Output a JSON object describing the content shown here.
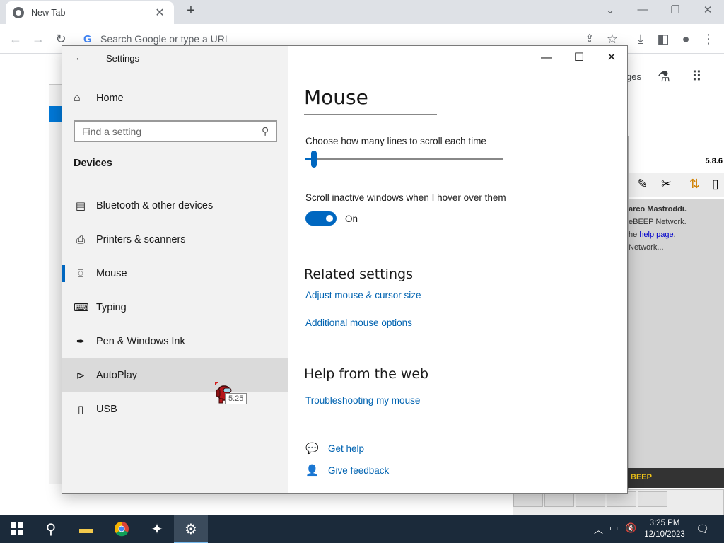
{
  "browser": {
    "tab_title": "New Tab",
    "tab_close": "✕",
    "new_tab": "+",
    "omnibox_placeholder": "Search Google or type a URL",
    "right_partial_text": "ges"
  },
  "beep": {
    "version": "5.8.6",
    "lines": [
      "arco Mastroddi.",
      "eBEEP Network.",
      "he",
      "help page",
      ".",
      "Network..."
    ],
    "footer": "BEEP"
  },
  "settings": {
    "window_title": "Settings",
    "home_label": "Home",
    "search_placeholder": "Find a setting",
    "section_label": "Devices",
    "nav_items": [
      {
        "label": "Bluetooth & other devices",
        "icon": "bluetooth-devices-icon"
      },
      {
        "label": "Printers & scanners",
        "icon": "printer-icon"
      },
      {
        "label": "Mouse",
        "icon": "mouse-icon"
      },
      {
        "label": "Typing",
        "icon": "keyboard-icon"
      },
      {
        "label": "Pen & Windows Ink",
        "icon": "pen-icon"
      },
      {
        "label": "AutoPlay",
        "icon": "autoplay-icon"
      },
      {
        "label": "USB",
        "icon": "usb-icon"
      }
    ],
    "selected_item": "Mouse",
    "page_title": "Mouse",
    "scroll_lines_label": "Choose how many lines to scroll each time",
    "scroll_lines_fraction": 0.03,
    "inactive_scroll_label": "Scroll inactive windows when I hover over them",
    "inactive_scroll_state": "On",
    "related_heading": "Related settings",
    "related_links": [
      "Adjust mouse & cursor size",
      "Additional mouse options"
    ],
    "help_heading": "Help from the web",
    "help_links": [
      "Troubleshooting my mouse"
    ],
    "get_help": "Get help",
    "give_feedback": "Give feedback",
    "accent_color": "#0067c0",
    "link_color": "#0063b1"
  },
  "cursor_tooltip": "5:25",
  "taskbar": {
    "time": "3:25 PM",
    "date": "12/10/2023"
  }
}
